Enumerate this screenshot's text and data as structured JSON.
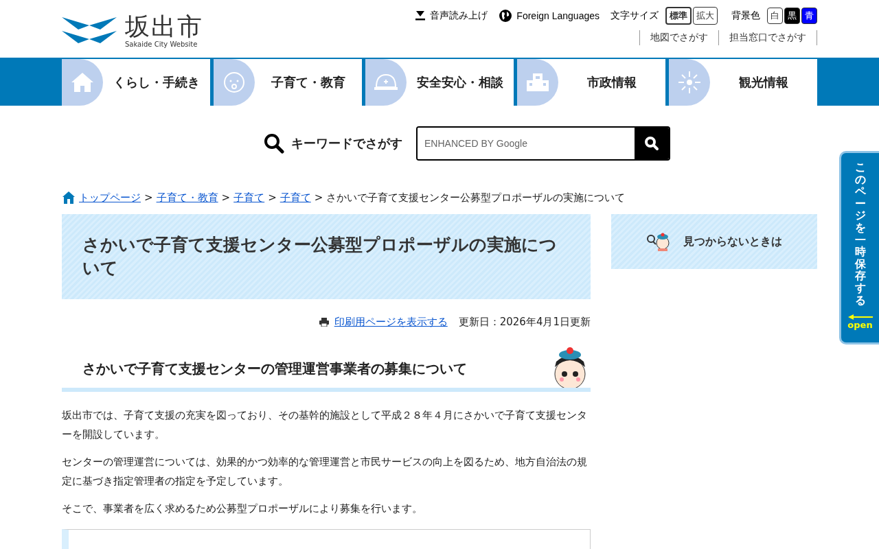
{
  "header": {
    "logo_title": "坂出市",
    "logo_subtitle": "Sakaide City Website",
    "tools": [
      {
        "kind": "speech",
        "label": "音声読み上げ"
      },
      {
        "kind": "language",
        "label": "Foreign Languages"
      }
    ],
    "font_size": {
      "label": "文字サイズ",
      "options": [
        {
          "label": "標準",
          "selected": true
        },
        {
          "label": "拡大",
          "selected": false
        }
      ]
    },
    "background": {
      "label": "背景色",
      "options": [
        {
          "label": "白",
          "color": "#ffffff"
        },
        {
          "label": "黒",
          "color": "#000000"
        },
        {
          "label": "青",
          "color": "#0000ff"
        }
      ]
    },
    "links": [
      "地図でさがす",
      "担当窓口でさがす"
    ]
  },
  "nav": [
    {
      "kind": "house",
      "label": "くらし・手続き"
    },
    {
      "kind": "baby",
      "label": "子育て・教育"
    },
    {
      "kind": "helmet",
      "label": "安全安心・相談"
    },
    {
      "kind": "building",
      "label": "市政情報"
    },
    {
      "kind": "firework",
      "label": "観光情報"
    }
  ],
  "search": {
    "label": "キーワードでさがす",
    "placeholder": "ENHANCED BY Google"
  },
  "breadcrumb": {
    "separator": ">",
    "links": [
      "トップページ",
      "子育て・教育",
      "子育て",
      "子育て"
    ],
    "current": "さかいで子育て支援センター公募型プロポーザルの実施について"
  },
  "page": {
    "title": "さかいで子育て支援センター公募型プロポーザルの実施について",
    "print_link": "印刷用ページを表示する",
    "updated": "更新日：2026年4月1日更新",
    "section_title": "さかいで子育て支援センターの管理運営事業者の募集について",
    "paragraphs": [
      "坂出市では、子育て支援の充実を図っており、その基幹的施設として平成２８年４月にさかいで子育て支援センターを開設しています。",
      "センターの管理運営については、効果的かつ効率的な管理運営と市民サービスの向上を図るため、地方自治法の規定に基づき指定管理者の指定を予定しています。",
      "そこで、事業者を広く求めるため公募型プロポーザルにより募集を行います。"
    ]
  },
  "sidebar": {
    "help_label": "見つからないときは"
  },
  "save_tab": {
    "label": "このページを一時保存する",
    "open": "open"
  }
}
